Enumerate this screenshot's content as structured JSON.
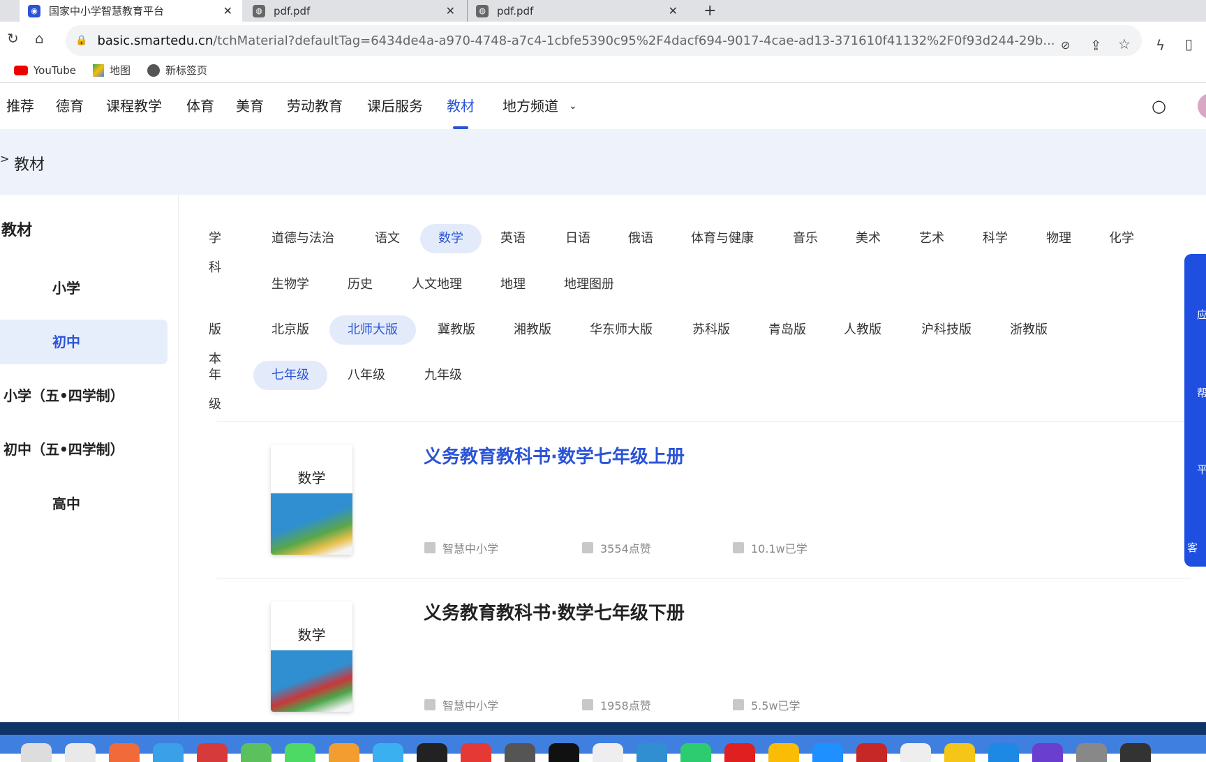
{
  "browser": {
    "tabs": [
      {
        "title": "国家中小学智慧教育平台",
        "active": true,
        "icon": "smartedu-icon"
      },
      {
        "title": "pdf.pdf",
        "active": false,
        "icon": "globe-icon"
      },
      {
        "title": "pdf.pdf",
        "active": false,
        "icon": "globe-icon"
      }
    ],
    "url_host": "basic.smartedu.cn",
    "url_path": "/tchMaterial?defaultTag=6434de4a-a970-4748-a7c4-1cbfe5390c95%2F4dacf694-9017-4cae-ad13-371610f41132%2F0f93d244-29b...",
    "bookmarks": [
      {
        "label": "YouTube",
        "icon": "youtube-icon"
      },
      {
        "label": "地图",
        "icon": "maps-icon"
      },
      {
        "label": "新标签页",
        "icon": "globe-icon"
      }
    ]
  },
  "nav": {
    "items": [
      "推荐",
      "德育",
      "课程教学",
      "体育",
      "美育",
      "劳动教育",
      "课后服务",
      "教材",
      "地方频道"
    ],
    "active": "教材"
  },
  "breadcrumb": {
    "sep": ">",
    "current": "教材"
  },
  "sidebar": {
    "title": "教材",
    "items": [
      "小学",
      "初中",
      "小学（五•四学制）",
      "初中（五•四学制）",
      "高中"
    ],
    "active": "初中"
  },
  "filters": {
    "subject": {
      "label": "学科",
      "items": [
        "道德与法治",
        "语文",
        "数学",
        "英语",
        "日语",
        "俄语",
        "体育与健康",
        "音乐",
        "美术",
        "艺术",
        "科学",
        "物理",
        "化学",
        "生物学",
        "历史",
        "人文地理",
        "地理",
        "地理图册"
      ],
      "active": "数学"
    },
    "edition": {
      "label": "版本",
      "items": [
        "北京版",
        "北师大版",
        "冀教版",
        "湘教版",
        "华东师大版",
        "苏科版",
        "青岛版",
        "人教版",
        "沪科技版",
        "浙教版"
      ],
      "active": "北师大版"
    },
    "grade": {
      "label": "年级",
      "items": [
        "七年级",
        "八年级",
        "九年级"
      ],
      "active": "七年级"
    }
  },
  "books": [
    {
      "title": "义务教育教科书·数学七年级上册",
      "cover_title": "数学",
      "publisher": "智慧中小学",
      "likes": "3554点赞",
      "learned": "10.1w已学",
      "highlighted": true
    },
    {
      "title": "义务教育教科书·数学七年级下册",
      "cover_title": "数学",
      "publisher": "智慧中小学",
      "likes": "1958点赞",
      "learned": "5.5w已学",
      "highlighted": false
    }
  ],
  "float_panel": {
    "items": [
      "应",
      "帮",
      "平",
      "客"
    ]
  },
  "colors": {
    "accent": "#2a53d6",
    "float": "#1f4fe0",
    "crumb_bg": "#eef2fa"
  }
}
